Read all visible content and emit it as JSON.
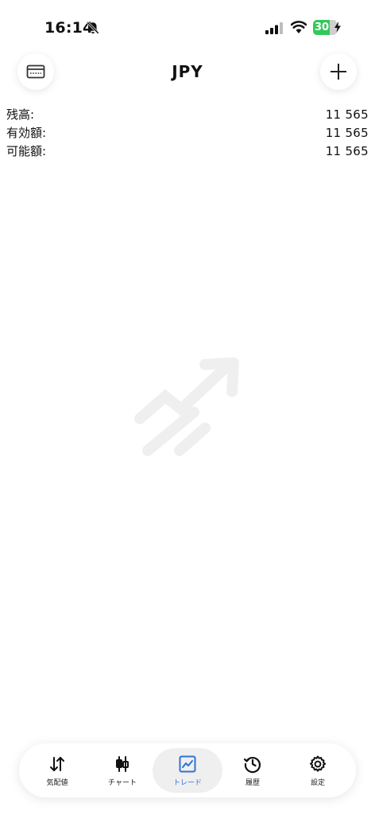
{
  "status_bar": {
    "time": "16:14",
    "battery": "30"
  },
  "header": {
    "title": "JPY"
  },
  "balances": [
    {
      "label": "残高:",
      "value": "11 565"
    },
    {
      "label": "有効額:",
      "value": "11 565"
    },
    {
      "label": "可能額:",
      "value": "11 565"
    }
  ],
  "nav": [
    {
      "label": "気配値",
      "icon": "arrows-up-down-icon"
    },
    {
      "label": "チャート",
      "icon": "candlestick-icon"
    },
    {
      "label": "トレード",
      "icon": "trade-chart-icon"
    },
    {
      "label": "履歴",
      "icon": "history-icon"
    },
    {
      "label": "設定",
      "icon": "gear-icon"
    }
  ],
  "colors": {
    "accent": "#2f72d6",
    "battery": "#34c759",
    "placeholder": "#f0f0f0"
  }
}
